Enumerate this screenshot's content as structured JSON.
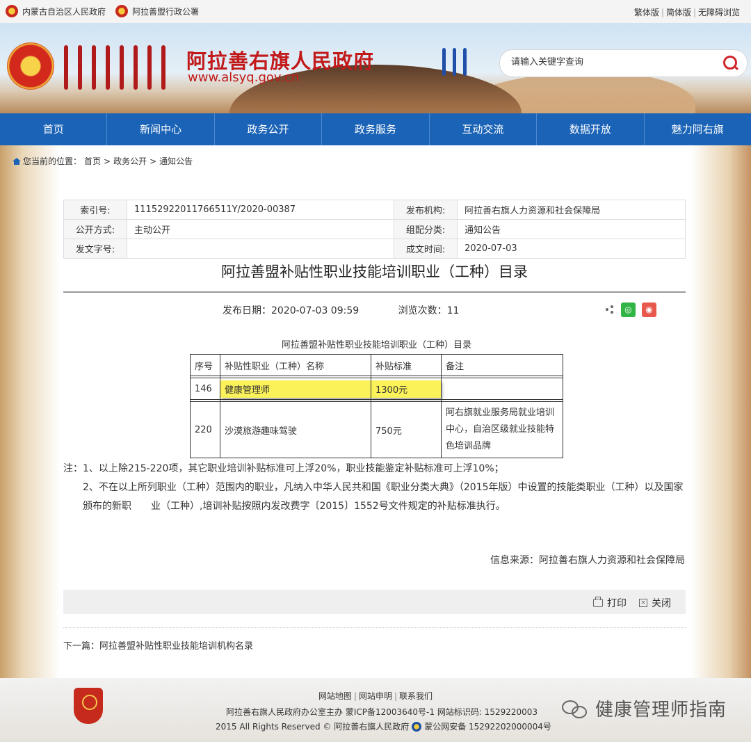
{
  "topbar": {
    "links_left": [
      "内蒙古自治区人民政府",
      "阿拉善盟行政公署"
    ],
    "links_right": [
      "繁体版",
      "简体版",
      "无障碍浏览"
    ]
  },
  "header": {
    "site_name": "阿拉善右旗人民政府",
    "site_url": "www.alsyq.gov.cn",
    "search_placeholder": "请输入关键字查询"
  },
  "nav": [
    "首页",
    "新闻中心",
    "政务公开",
    "政务服务",
    "互动交流",
    "数据开放",
    "魅力阿右旗"
  ],
  "breadcrumb": {
    "prefix": "您当前的位置：",
    "items": [
      "首页",
      "政务公开",
      "通知公告"
    ],
    "sep": ">"
  },
  "meta": {
    "index_label": "索引号:",
    "index_value": "11152922011766511Y/2020-00387",
    "org_label": "发布机构:",
    "org_value": "阿拉善右旗人力资源和社会保障局",
    "open_label": "公开方式:",
    "open_value": "主动公开",
    "category_label": "组配分类:",
    "category_value": "通知公告",
    "doc_label": "发文字号:",
    "doc_value": "",
    "date_label": "成文时间:",
    "date_value": "2020-07-03"
  },
  "article": {
    "title": "阿拉善盟补贴性职业技能培训职业（工种）目录",
    "publish_label": "发布日期：",
    "publish_value": "2020-07-03 09:59",
    "views_label": "浏览次数：",
    "views_value": "11",
    "table_caption": "阿拉善盟补贴性职业技能培训职业（工种）目录",
    "table_headers": [
      "序号",
      "补贴性职业（工种）名称",
      "补贴标准",
      "备注"
    ],
    "rows": [
      {
        "no": "146",
        "name": "健康管理师",
        "subsidy": "1300元",
        "note": ""
      },
      {
        "no": "220",
        "name": "沙漠旅游趣味驾驶",
        "subsidy": "750元",
        "note": "阿右旗就业服务局就业培训中心，自治区级就业技能特色培训品牌"
      }
    ],
    "note1": "注：1、以上除215-220项，其它职业培训补贴标准可上浮20%，职业技能鉴定补贴标准可上浮10%；",
    "note2": "2、不在以上所列职业（工种）范围内的职业，凡纳入中华人民共和国《职业分类大典》（2015年版）中设置的技能类职业（工种）以及国家颁布的新职　　业（工种）,培训补贴按照内发改费字〔2015〕1552号文件规定的补贴标准执行。",
    "source": "信息来源：阿拉善右旗人力资源和社会保障局"
  },
  "actions": {
    "print": "打印",
    "close": "关闭"
  },
  "next": "下一篇：阿拉善盟补贴性职业技能培训机构名录",
  "footer": {
    "links": [
      "网站地图",
      "网站申明",
      "联系我们"
    ],
    "line2": "阿拉善右旗人民政府办公室主办 蒙ICP备12003640号-1 网站标识码: 1529220003",
    "line3_a": "2015 All Rights Reserved © 阿拉善右旗人民政府",
    "line3_b": "蒙公网安备 15292202000004号",
    "watermark": "健康管理师指南"
  },
  "colors": {
    "nav_bg": "#1b63b7",
    "title_red": "#c21a1a",
    "highlight": "#fbf25a"
  }
}
